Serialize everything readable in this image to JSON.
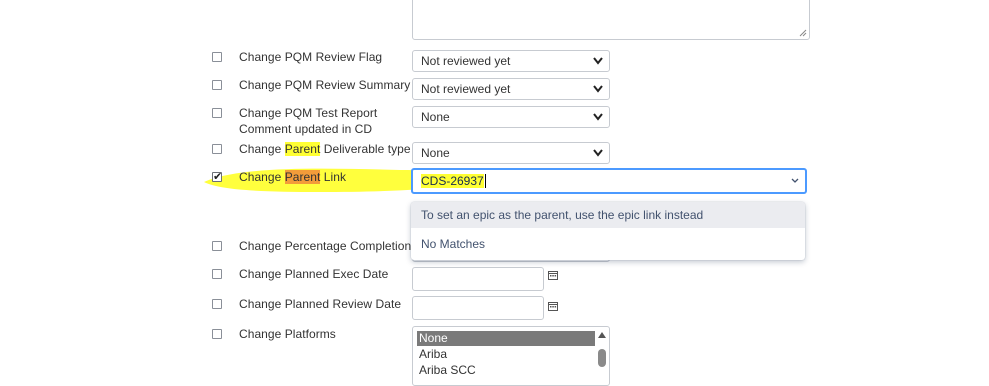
{
  "form": {
    "rows": [
      {
        "label_parts": [
          "Change PQM Review Flag"
        ],
        "checked": false,
        "control": "select",
        "value": "Not reviewed yet"
      },
      {
        "label_parts": [
          "Change PQM Review Summary"
        ],
        "checked": false,
        "control": "select",
        "value": "Not reviewed yet"
      },
      {
        "label_line1": "Change PQM Test Report",
        "label_line2": "Comment updated in CD",
        "checked": false,
        "control": "select",
        "value": "None"
      },
      {
        "label_pre": "Change ",
        "label_hl": "Parent",
        "label_post": " Deliverable type",
        "checked": false,
        "control": "select",
        "value": "None"
      },
      {
        "label_pre": "Change ",
        "label_hl": "Parent",
        "label_post": " Link",
        "checked": true,
        "control": "combobox",
        "value": "CDS-26937"
      },
      {
        "label_parts": [
          "Change Percentage Completion"
        ],
        "checked": false,
        "control": "hidden"
      },
      {
        "label_parts": [
          "Change Planned Exec Date"
        ],
        "checked": false,
        "control": "date",
        "value": ""
      },
      {
        "label_parts": [
          "Change Planned Review Date"
        ],
        "checked": false,
        "control": "date",
        "value": ""
      },
      {
        "label_parts": [
          "Change Platforms"
        ],
        "checked": false,
        "control": "listbox"
      }
    ],
    "dropdown": {
      "hint": "To set an epic as the parent, use the epic link instead",
      "no_matches": "No Matches"
    },
    "platforms_options": [
      "None",
      "Ariba",
      "Ariba SCC"
    ],
    "platforms_selected": "None"
  },
  "colors": {
    "focus_border": "#4c9aff",
    "highlight_yellow": "#ffff33",
    "highlight_orange": "#f39c3a",
    "hint_bg": "#ebecf0"
  },
  "icons": {
    "select_caret": "chevron-down-icon",
    "calendar": "calendar-icon",
    "resize": "resize-grip-icon"
  }
}
